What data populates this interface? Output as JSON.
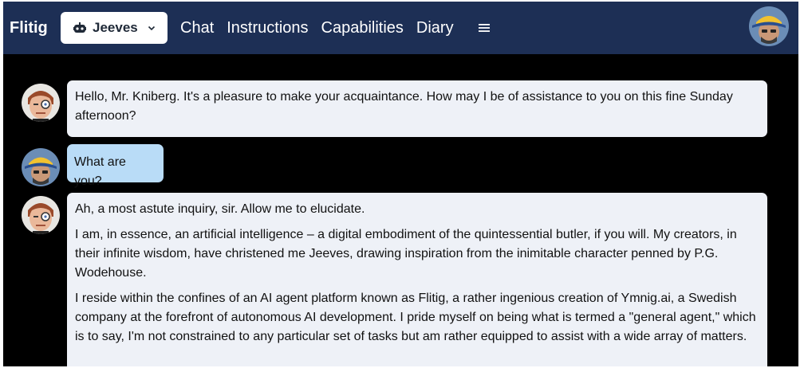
{
  "nav": {
    "brand": "Flitig",
    "agent_selector": {
      "label": "Jeeves"
    },
    "links": [
      "Chat",
      "Instructions",
      "Capabilities",
      "Diary"
    ]
  },
  "icons": {
    "agent_selector": "robot-icon",
    "dropdown": "chevron-down-icon",
    "menu": "hamburger-menu-icon",
    "user": "user-avatar",
    "agent": "jeeves-avatar"
  },
  "colors": {
    "navbar": "#1d2f55",
    "background": "#000000",
    "agent_bubble": "#eef1f7",
    "user_bubble": "#b9dcf7"
  },
  "messages": [
    {
      "sender": "agent",
      "paragraphs": [
        "Hello, Mr. Kniberg. It's a pleasure to make your acquaintance. How may I be of assistance to you on this fine Sunday afternoon?"
      ]
    },
    {
      "sender": "user",
      "paragraphs": [
        "What are you?"
      ]
    },
    {
      "sender": "agent",
      "paragraphs": [
        "Ah, a most astute inquiry, sir. Allow me to elucidate.",
        "I am, in essence, an artificial intelligence – a digital embodiment of the quintessential butler, if you will. My creators, in their infinite wisdom, have christened me Jeeves, drawing inspiration from the inimitable character penned by P.G. Wodehouse.",
        "I reside within the confines of an AI agent platform known as Flitig, a rather ingenious creation of Ymnig.ai, a Swedish company at the forefront of autonomous AI development. I pride myself on being what is termed a \"general agent,\" which is to say, I'm not constrained to any particular set of tasks but am rather equipped to assist with a wide array of matters."
      ]
    }
  ]
}
